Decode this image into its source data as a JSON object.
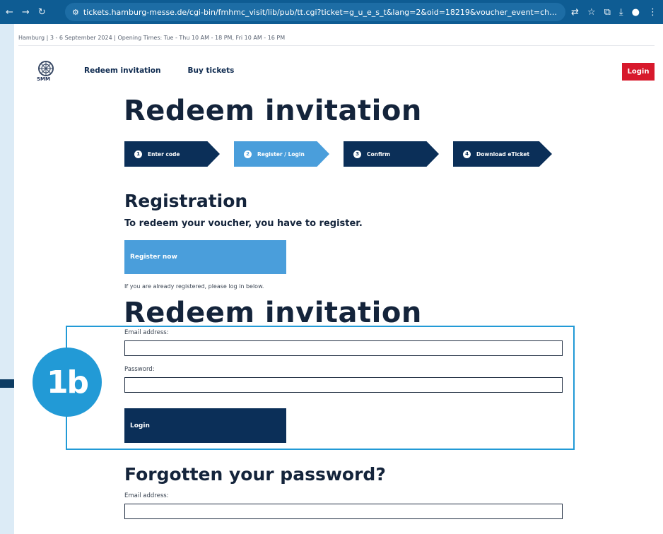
{
  "browser": {
    "url": "tickets.hamburg-messe.de/cgi-bin/fmhmc_visit/lib/pub/tt.cgi?ticket=g_u_e_s_t&lang=2&oid=18219&voucher_event=check_voucher&voucher_code=txfm-hdkv-jhxw-htoc#/",
    "nav_icons": [
      "back-icon",
      "forward-icon",
      "reload-icon"
    ],
    "right_icons": [
      "translate-icon",
      "star-icon",
      "extensions-icon",
      "download-icon",
      "profile-icon",
      "menu-icon"
    ]
  },
  "infobar": {
    "text": "Hamburg | 3 - 6 September 2024 | Opening Times: Tue - Thu 10 AM - 18 PM, Fri 10 AM - 16 PM"
  },
  "header": {
    "logo_text": "SMM",
    "nav": [
      "Redeem invitation",
      "Buy tickets"
    ],
    "login_label": "Login"
  },
  "main": {
    "title": "Redeem invitation",
    "steps": [
      {
        "num": "1",
        "label": "Enter code"
      },
      {
        "num": "2",
        "label": "Register / Login"
      },
      {
        "num": "3",
        "label": "Confirm"
      },
      {
        "num": "4",
        "label": "Download eTicket"
      }
    ],
    "registration": {
      "heading": "Registration",
      "lead": "To redeem your voucher, you have to register.",
      "button": "Register now",
      "note": "If you are already registered, please log in below."
    },
    "login_form": {
      "title": "Redeem invitation",
      "email_label": "Email address:",
      "email_value": "",
      "password_label": "Password:",
      "password_value": "",
      "button": "Login"
    },
    "forgot": {
      "heading": "Forgotten your password?",
      "email_label": "Email address:",
      "email_value": ""
    }
  },
  "annotation": {
    "badge": "1b"
  },
  "colors": {
    "chrome": "#0e5c93",
    "brand_dark": "#0b2f58",
    "step_active": "#4a9edb",
    "login_red": "#d7192c",
    "highlight": "#229ad6",
    "side_bg": "#dcebf6"
  }
}
